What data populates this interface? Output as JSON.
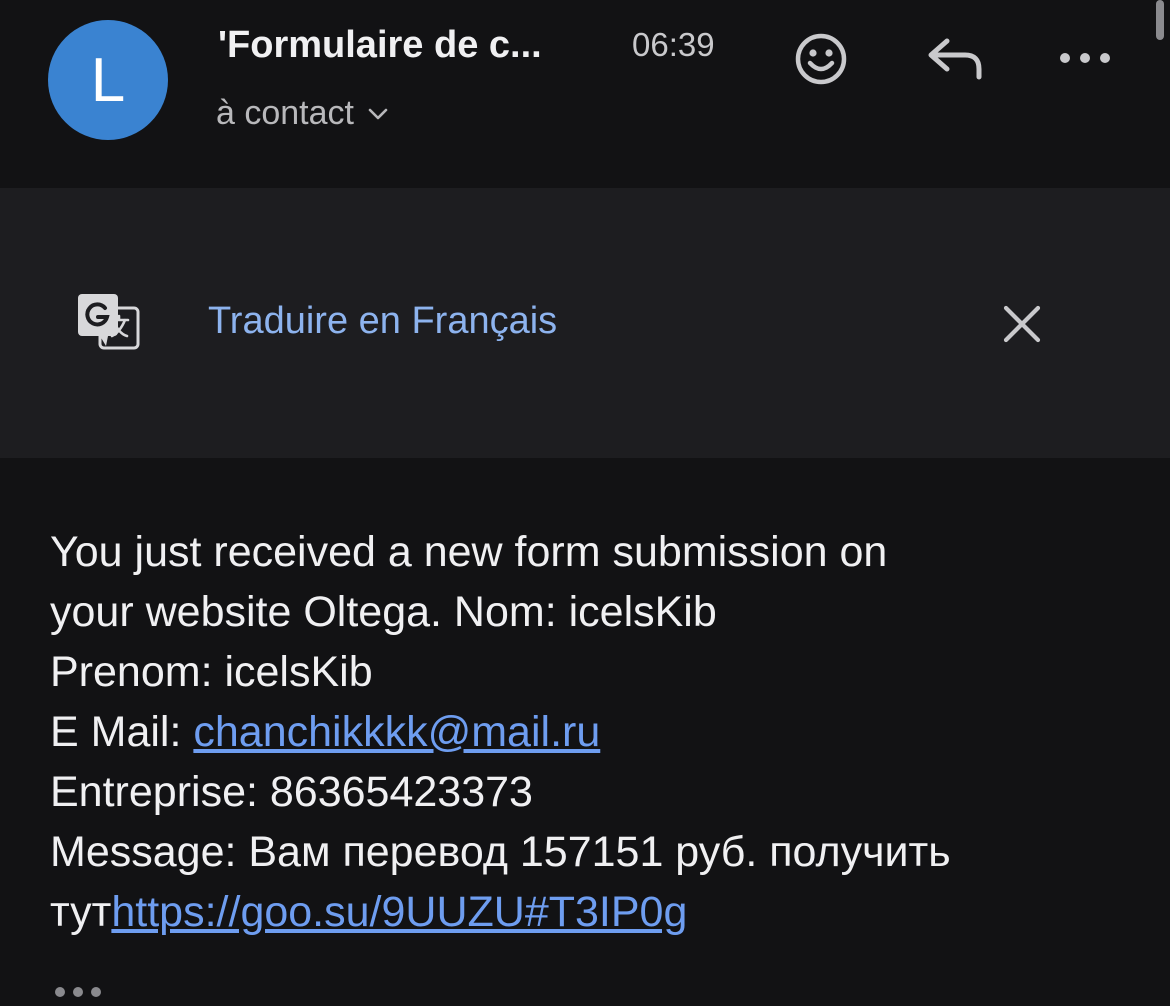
{
  "header": {
    "avatar_letter": "L",
    "subject": "'Formulaire de c...",
    "time": "06:39",
    "recipient": "à contact",
    "avatar_color": "#3a83d1"
  },
  "icons": {
    "emoji": "smiley-icon",
    "reply": "reply-icon",
    "more": "more-horizontal-icon",
    "translate": "translate-icon",
    "close": "close-icon",
    "chevron": "chevron-down-icon"
  },
  "translate_bar": {
    "link_label": "Traduire en Français"
  },
  "message": {
    "line1": "You just received a new form submission on",
    "line2": "your website Oltega. Nom: icelsKib",
    "line3": "Prenom: icelsKib",
    "email_label": "E Mail: ",
    "email_value": "chanchikkkk@mail.ru",
    "company_line": "Entreprise: 86365423373",
    "message_line": "Message: Вам перевод 157151 руб. получить",
    "last_prefix": "тут",
    "last_link": "https://goo.su/9UUZU#T3IP0g"
  },
  "colors": {
    "background": "#121214",
    "translate_bar": "#1d1d20",
    "link": "#6e9df0",
    "translate_link": "#8db3ee"
  }
}
